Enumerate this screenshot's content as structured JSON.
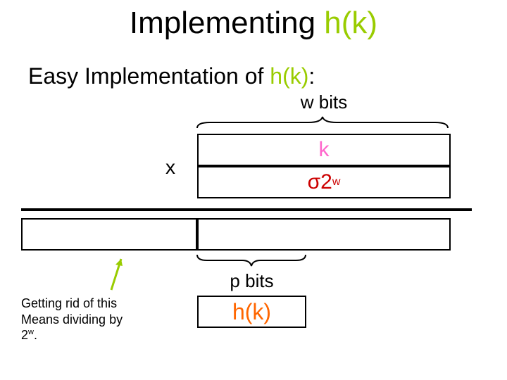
{
  "title_prefix": "Implementing ",
  "title_hk": "h(k)",
  "subtitle_prefix": "Easy Implementation of ",
  "subtitle_hk": "h(k)",
  "subtitle_suffix": ":",
  "wbits_label": "w bits",
  "x_symbol": "x",
  "cell_k": "k",
  "cell_sigma_sigma": "σ",
  "cell_sigma_two": "2",
  "cell_sigma_exp": "w",
  "pbits_label": "p bits",
  "result_hk": "h(k)",
  "caption_line1": "Getting rid of this",
  "caption_line2": "Means dividing by",
  "caption_line3_prefix": "2",
  "caption_line3_exp": "w",
  "caption_line3_suffix": "."
}
